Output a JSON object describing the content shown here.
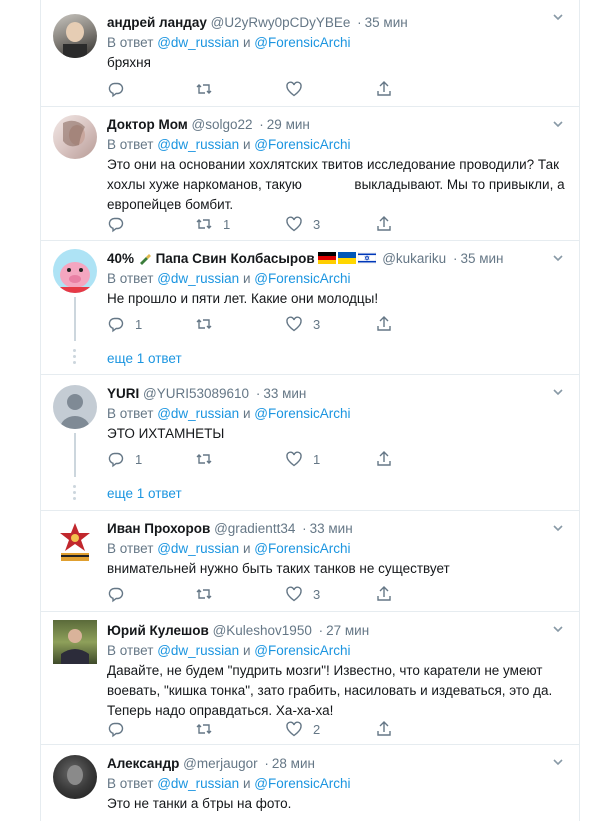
{
  "reply_word": "В ответ",
  "and_word": "и",
  "sep": "·",
  "tweets": [
    {
      "name": "андрей ландау",
      "handle": "@U2yRwy0pCDyYBEe",
      "time": "35 мин",
      "mention1": "@dw_russian",
      "mention2": "@ForensicArchi",
      "text": "бряхня",
      "reply_count": "",
      "retweet_count": "",
      "like_count": ""
    },
    {
      "name": "Доктор Мом",
      "handle": "@solgo22",
      "time": "29 мин",
      "mention1": "@dw_russian",
      "mention2": "@ForensicArchi",
      "text_lines": [
        "Это они на основании хохлятских твитов исследование проводили? Так",
        "хохлы хуже наркоманов, такую              выкладывают. Мы то привыкли, а",
        "европейцев бомбит."
      ],
      "reply_count": "",
      "retweet_count": "1",
      "like_count": "3"
    },
    {
      "name": "40%",
      "name_suffix": "Папа Свин Колбасыров",
      "handle": "@kukariku",
      "time": "35 мин",
      "mention1": "@dw_russian",
      "mention2": "@ForensicArchi",
      "text": "Не прошло и пяти лет. Какие они молодцы!",
      "reply_count": "1",
      "retweet_count": "",
      "like_count": "3",
      "more": "еще 1 ответ"
    },
    {
      "name": "YURI",
      "handle": "@YURI53089610",
      "time": "33 мин",
      "mention1": "@dw_russian",
      "mention2": "@ForensicArchi",
      "text": "ЭТО ИХТАМНЕТЫ",
      "reply_count": "1",
      "retweet_count": "",
      "like_count": "1",
      "more": "еще 1 ответ"
    },
    {
      "name": "Иван Прохоров",
      "handle": "@gradientt34",
      "time": "33 мин",
      "mention1": "@dw_russian",
      "mention2": "@ForensicArchi",
      "text": "внимательней нужно быть таких танков не существует",
      "reply_count": "",
      "retweet_count": "",
      "like_count": "3"
    },
    {
      "name": "Юрий Кулешов",
      "handle": "@Kuleshov1950",
      "time": "27 мин",
      "mention1": "@dw_russian",
      "mention2": "@ForensicArchi",
      "text_lines": [
        "Давайте, не будем \"пудрить мозги\"! Известно, что каратели не умеют",
        "воевать, \"кишка тонка\", зато грабить, насиловать и издеваться, это да.",
        "Теперь надо оправдаться. Ха-ха-ха!"
      ],
      "reply_count": "",
      "retweet_count": "",
      "like_count": "2"
    },
    {
      "name": "Александр",
      "handle": "@merjaugor",
      "time": "28 мин",
      "mention1": "@dw_russian",
      "mention2": "@ForensicArchi",
      "text": "Это не танки а бтры на фото."
    }
  ],
  "colors": {
    "link": "#1b95e0",
    "secondary": "#657786",
    "border": "#e6ecf0",
    "thread": "#ccd6dd"
  }
}
